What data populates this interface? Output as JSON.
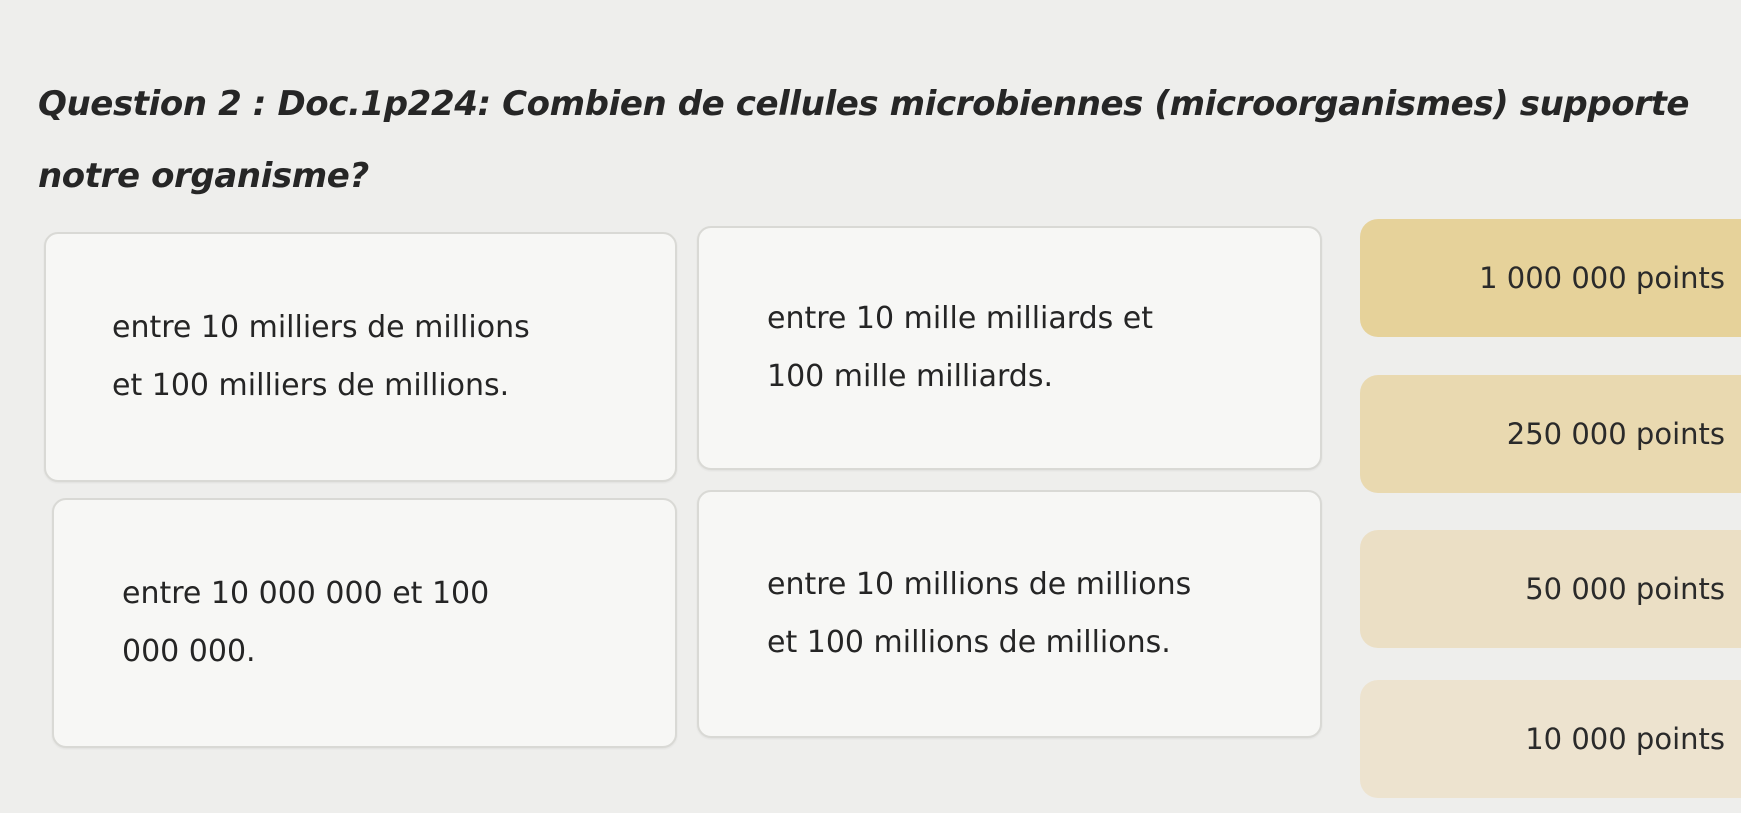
{
  "question": {
    "text": "Question 2 : Doc.1p224: Combien de cellules microbiennes (microorganismes) supporte notre organisme?"
  },
  "answers": [
    {
      "label": "entre 10 milliers de millions\net 100 milliers de millions."
    },
    {
      "label": "entre 10 mille milliards et\n100 mille milliards."
    },
    {
      "label": "entre 10 000 000 et 100\n000 000."
    },
    {
      "label": "entre 10 millions de millions\net 100 millions de millions."
    }
  ],
  "points_ladder": [
    {
      "label": "1 000 000 points"
    },
    {
      "label": "250 000 points"
    },
    {
      "label": "50 000 points"
    },
    {
      "label": "10 000 points"
    }
  ],
  "colors": {
    "background": "#eeeeec",
    "answer_card": "#f7f7f5",
    "points_top": "#e6d29a",
    "points_bottom": "#ede3cf"
  }
}
